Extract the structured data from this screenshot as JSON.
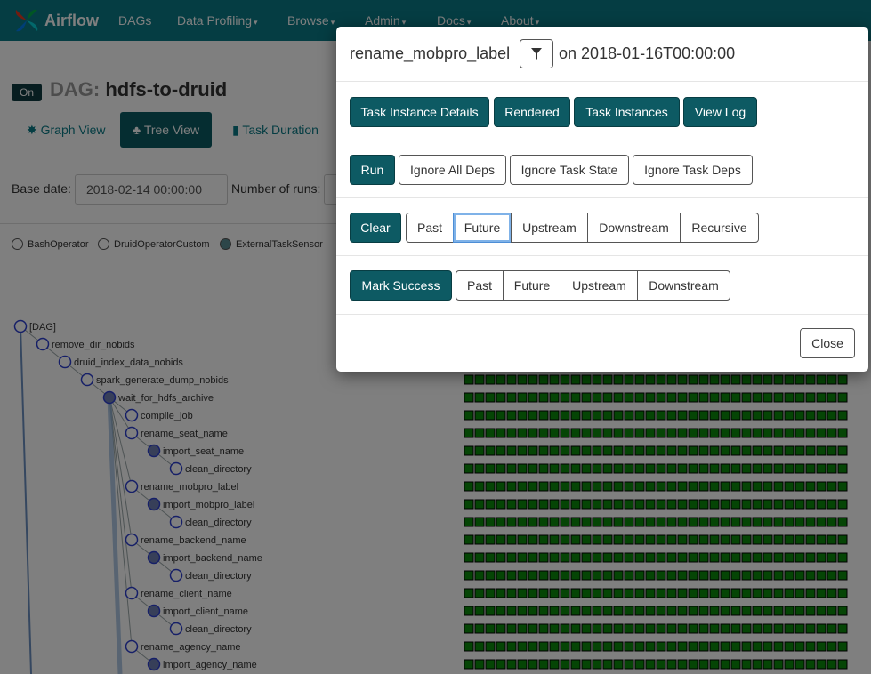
{
  "navbar": {
    "brand": "Airflow",
    "items": [
      {
        "label": "DAGs",
        "dropdown": false
      },
      {
        "label": "Data Profiling",
        "dropdown": true
      },
      {
        "label": "Browse",
        "dropdown": true
      },
      {
        "label": "Admin",
        "dropdown": true
      },
      {
        "label": "Docs",
        "dropdown": true
      },
      {
        "label": "About",
        "dropdown": true
      }
    ]
  },
  "dag": {
    "toggle": "On",
    "label": "DAG:",
    "name": "hdfs-to-druid"
  },
  "tabs": [
    {
      "label": "Graph View",
      "icon": "graph-icon",
      "active": false
    },
    {
      "label": "Tree View",
      "icon": "tree-icon",
      "active": true
    },
    {
      "label": "Task Duration",
      "icon": "bar-chart-icon",
      "active": false
    }
  ],
  "form": {
    "base_date_label": "Base date:",
    "base_date_value": "2018-02-14 00:00:00",
    "num_runs_label": "Number of runs:"
  },
  "legend": [
    "BashOperator",
    "DruidOperatorCustom",
    "ExternalTaskSensor"
  ],
  "tree": {
    "nodes": [
      {
        "label": "[DAG]",
        "depth": 0,
        "filled": false
      },
      {
        "label": "remove_dir_nobids",
        "depth": 1,
        "filled": false
      },
      {
        "label": "druid_index_data_nobids",
        "depth": 2,
        "filled": false
      },
      {
        "label": "spark_generate_dump_nobids",
        "depth": 3,
        "filled": false
      },
      {
        "label": "wait_for_hdfs_archive",
        "depth": 4,
        "filled": true
      },
      {
        "label": "compile_job",
        "depth": 5,
        "filled": false
      },
      {
        "label": "rename_seat_name",
        "depth": 5,
        "filled": false
      },
      {
        "label": "import_seat_name",
        "depth": 6,
        "filled": true
      },
      {
        "label": "clean_directory",
        "depth": 7,
        "filled": false
      },
      {
        "label": "rename_mobpro_label",
        "depth": 5,
        "filled": false
      },
      {
        "label": "import_mobpro_label",
        "depth": 6,
        "filled": true
      },
      {
        "label": "clean_directory",
        "depth": 7,
        "filled": false
      },
      {
        "label": "rename_backend_name",
        "depth": 5,
        "filled": false
      },
      {
        "label": "import_backend_name",
        "depth": 6,
        "filled": true
      },
      {
        "label": "clean_directory",
        "depth": 7,
        "filled": false
      },
      {
        "label": "rename_client_name",
        "depth": 5,
        "filled": false
      },
      {
        "label": "import_client_name",
        "depth": 6,
        "filled": true
      },
      {
        "label": "clean_directory",
        "depth": 7,
        "filled": false
      },
      {
        "label": "rename_agency_name",
        "depth": 5,
        "filled": false
      },
      {
        "label": "import_agency_name",
        "depth": 6,
        "filled": true
      }
    ],
    "status_color": "#0a8a0a"
  },
  "modal": {
    "task": "rename_mobpro_label",
    "on_label": "on",
    "execution_date": "2018-01-16T00:00:00",
    "info_buttons": [
      "Task Instance Details",
      "Rendered",
      "Task Instances",
      "View Log"
    ],
    "run": {
      "label": "Run",
      "options": [
        "Ignore All Deps",
        "Ignore Task State",
        "Ignore Task Deps"
      ]
    },
    "clear": {
      "label": "Clear",
      "options": [
        "Past",
        "Future",
        "Upstream",
        "Downstream",
        "Recursive"
      ]
    },
    "mark_success": {
      "label": "Mark Success",
      "options": [
        "Past",
        "Future",
        "Upstream",
        "Downstream"
      ]
    },
    "close_label": "Close"
  },
  "colors": {
    "navbar": "#0a7a86",
    "primary_button": "#0d5a63",
    "success_cell": "#0a8a0a"
  }
}
